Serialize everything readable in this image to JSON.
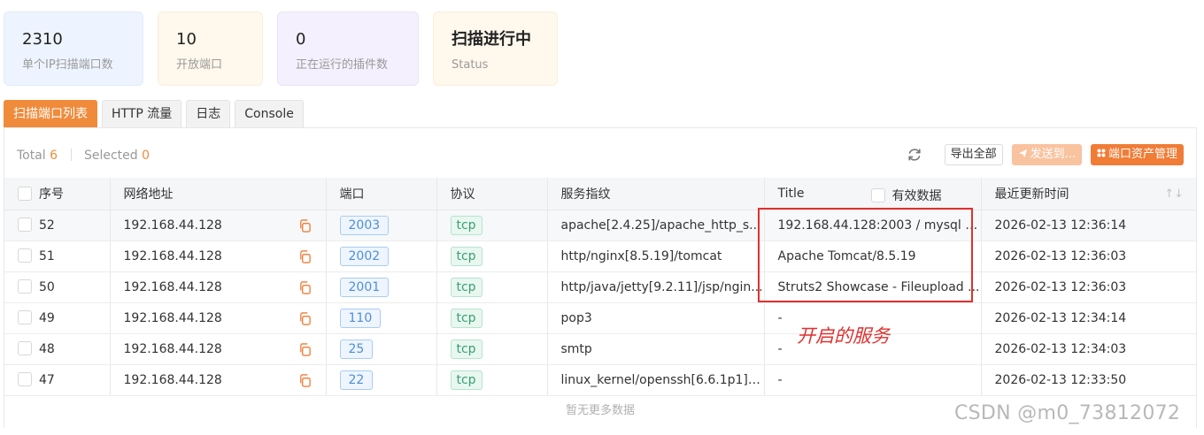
{
  "stats": [
    {
      "value": "2310",
      "label": "单个IP扫描端口数"
    },
    {
      "value": "10",
      "label": "开放端口"
    },
    {
      "value": "0",
      "label": "正在运行的插件数"
    },
    {
      "value": "扫描进行中",
      "label": "Status"
    }
  ],
  "tabs": [
    "扫描端口列表",
    "HTTP 流量",
    "日志",
    "Console"
  ],
  "toolbar": {
    "total_label": "Total",
    "total_value": "6",
    "selected_label": "Selected",
    "selected_value": "0",
    "export_label": "导出全部",
    "send_label": "发送到...",
    "asset_label": "端口资产管理"
  },
  "columns": {
    "seq": "序号",
    "address": "网络地址",
    "port": "端口",
    "protocol": "协议",
    "fingerprint": "服务指纹",
    "title": "Title",
    "valid_data": "有效数据",
    "updated": "最近更新时间"
  },
  "rows": [
    {
      "seq": "52",
      "address": "192.168.44.128",
      "port": "2003",
      "protocol": "tcp",
      "fingerprint": "apache[2.4.25]/apache_http_s...",
      "title": "192.168.44.128:2003 / mysql | ...",
      "updated": "2026-02-13 12:36:14"
    },
    {
      "seq": "51",
      "address": "192.168.44.128",
      "port": "2002",
      "protocol": "tcp",
      "fingerprint": "http/nginx[8.5.19]/tomcat",
      "title": "Apache Tomcat/8.5.19",
      "updated": "2026-02-13 12:36:03"
    },
    {
      "seq": "50",
      "address": "192.168.44.128",
      "port": "2001",
      "protocol": "tcp",
      "fingerprint": "http/java/jetty[9.2.11]/jsp/ngin...",
      "title": "Struts2 Showcase - Fileupload ...",
      "updated": "2026-02-13 12:36:03"
    },
    {
      "seq": "49",
      "address": "192.168.44.128",
      "port": "110",
      "protocol": "tcp",
      "fingerprint": "pop3",
      "title": "-",
      "updated": "2026-02-13 12:34:14"
    },
    {
      "seq": "48",
      "address": "192.168.44.128",
      "port": "25",
      "protocol": "tcp",
      "fingerprint": "smtp",
      "title": "-",
      "updated": "2026-02-13 12:34:03"
    },
    {
      "seq": "47",
      "address": "192.168.44.128",
      "port": "22",
      "protocol": "tcp",
      "fingerprint": "linux_kernel/openssh[6.6.1p1]/...",
      "title": "-",
      "updated": "2026-02-13 12:33:50"
    }
  ],
  "footer_note": "暂无更多数据",
  "annotation": "开启的服务",
  "watermark": "CSDN @m0_73812072",
  "colors": {
    "accent": "#f08b3c",
    "annotation": "#e0302f"
  },
  "icons": {
    "refresh": "refresh-icon",
    "copy": "copy-icon",
    "send": "send-icon",
    "grid": "grid-icon",
    "sort": "sort-icon"
  }
}
